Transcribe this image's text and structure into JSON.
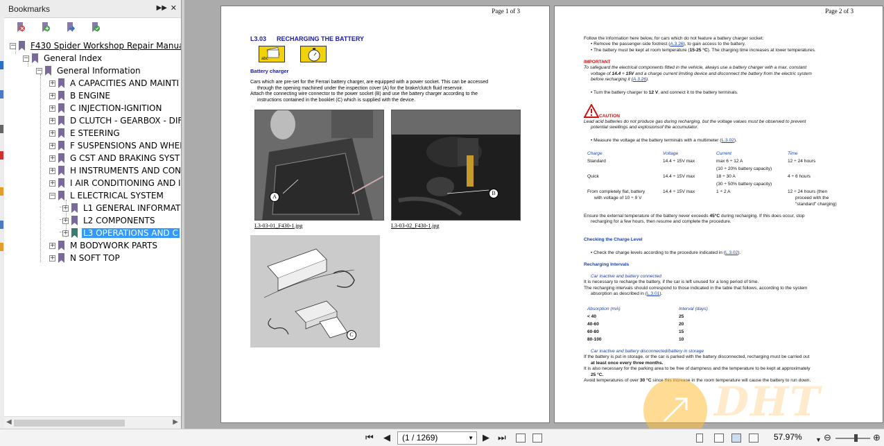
{
  "bookmarks": {
    "title": "Bookmarks",
    "tree": [
      {
        "label": "F430  Spider Workshop Repair Manual"
      },
      {
        "label": "General Index"
      },
      {
        "label": "General Information"
      },
      {
        "label": "A CAPACITIES AND MAINTI"
      },
      {
        "label": "B ENGINE"
      },
      {
        "label": "C INJECTION-IGNITION"
      },
      {
        "label": "D CLUTCH - GEARBOX - DIF"
      },
      {
        "label": "E STEERING"
      },
      {
        "label": "F SUSPENSIONS AND WHEI"
      },
      {
        "label": "G CST AND BRAKING SYST"
      },
      {
        "label": "H INSTRUMENTS AND CON"
      },
      {
        "label": "I AIR CONDITIONING AND I"
      },
      {
        "label": "L ELECTRICAL SYSTEM"
      },
      {
        "label": "L1 GENERAL INFORMAT"
      },
      {
        "label": "L2 COMPONENTS"
      },
      {
        "label": "L3 OPERATIONS AND C"
      },
      {
        "label": "M BODYWORK PARTS"
      },
      {
        "label": "N SOFT TOP"
      }
    ]
  },
  "page1": {
    "page_num": "Page 1 of 3",
    "section": "L3.03",
    "title": "RECHARGING THE BATTERY",
    "icon_label": "abc",
    "subtitle": "Battery charger",
    "para1a": "Cars which are pre-set for the Ferrari battery charger, are equipped with a power socket.  This can be accessed",
    "para1b": "through the opening machined under the inspection cover (A) for the brake/clutch fluid reservoir.",
    "para2a": "Attach the connecting wire connector to the power socket (B) and use the battery charger according to the",
    "para2b": "instructions contained in the booklet (C) which is supplied with the device.",
    "caption1": "L3-03-01_F430-1.jpg",
    "caption2": "L3-03-02_F430-1.jpg",
    "callout_a": "A",
    "callout_b": "B",
    "callout_c": "C"
  },
  "page2": {
    "page_num": "Page 2 of 3",
    "l1": "Follow the information here below, for cars which do not feature a battery charger socket:",
    "l2a": "•  Remove the passenger-side footrest (",
    "l2link": "A.3.26",
    "l2b": "), to gain access to the battery.",
    "l3a": "•  The battery must be kept at room temperature (",
    "l3b": "15-25 °C",
    "l3c": "). The charging time increases at lower temperatures.",
    "important": "IMPORTANT",
    "imp1": "To safeguard the electrical components fitted in the vehicle, always use a battery charger with a max. constant",
    "imp2a": "voltage of ",
    "imp2b": "14.4 ÷ 15V",
    "imp2c": " and a charge current limiting device and disconnect the battery from the electric system",
    "imp3a": "before recharging it (",
    "imp3link": "A.3.26",
    "imp3b": ").",
    "l4a": "•  Turn the battery charger to ",
    "l4b": "12 V",
    "l4c": ", and connect it to the battery terminals.",
    "caution": "CAUTION",
    "c1": "Lead acid batteries do not produce gas during recharging, but the voltage values must be observed to prevent",
    "c2": "potential swellings and explosionsof the accumulator.",
    "l5a": "•  Measure the voltage at the battery terminals with a multimeter (",
    "l5link": "L.3.02",
    "l5b": ").",
    "t1": {
      "headers": [
        "Charge",
        "Voltage",
        "Current",
        "Time"
      ],
      "rows": [
        [
          "Standard",
          "14.4 ÷ 15V max",
          "max 6 ÷ 12 A",
          "12 ÷ 24 hours"
        ],
        [
          "",
          "",
          "(10 ÷ 20% battery capacity)",
          ""
        ],
        [
          "Quick",
          "14.4 ÷ 15V max",
          "18 ÷ 30 A",
          "4 ÷ 6 hours"
        ],
        [
          "",
          "",
          "(30 ÷ 50% battery capacity)",
          ""
        ],
        [
          "From completely flat, battery",
          "14.4 ÷ 15V max",
          "1 ÷ 2 A",
          "12 ÷ 24 hours (then"
        ],
        [
          "with voltage of 10 ÷ 9 V",
          "",
          "",
          "proceed with the"
        ],
        [
          "",
          "",
          "",
          "\"standard\" charging)"
        ]
      ]
    },
    "l6a": "Ensure the external temperature of the battery never exceeds ",
    "l6b": "45°C",
    "l6c": " during recharging. If this does occur, stop",
    "l6d": "recharging for a few hours, then resume and complete the procedure.",
    "h_check": "Checking the Charge Level",
    "l7a": "•  Check the charge levels according to the procedure indicated in (",
    "l7link": "L.3.02",
    "l7b": ").",
    "h_intervals": "Recharging Intervals",
    "sub1": "Car inactive and battery connected",
    "l8": "It is necessary to recharge the battery, if the car is left unused for a long period of time.",
    "l9": "The recharging intervals should correspond to those indicated in the table that follows, according to the system",
    "l10a": "absorption as described in (",
    "l10link": "L.3.01",
    "l10b": ").",
    "t2": {
      "headers": [
        "Absorption (mA)",
        "Interval (days)"
      ],
      "rows": [
        [
          "< 40",
          "25"
        ],
        [
          "40-60",
          "20"
        ],
        [
          "60-80",
          "15"
        ],
        [
          "80-100",
          "10"
        ]
      ]
    },
    "sub2": "Car inactive and battery disconnected/battery in storage",
    "l11": "If the battery is put in storage, or the car is parked with the battery disconnected, recharging must be carried out",
    "l12": "at least once every three months.",
    "l13": "It is also necessary for the parking area to be free of dampness and the temperature to be kept at approximately",
    "l14": "25 °C.",
    "l15a": "Avoid temperatures of over ",
    "l15b": "30 °C",
    "l15c": " since this increase in the room temperature will cause the battery to run down."
  },
  "watermark": "DHT",
  "toolbar": {
    "page_indicator": "(1 / 1269)",
    "zoom": "57.97%"
  },
  "colors": {
    "accent": "#3399ff",
    "heading_blue": "#1a1aa8",
    "important_red": "#d01010"
  }
}
